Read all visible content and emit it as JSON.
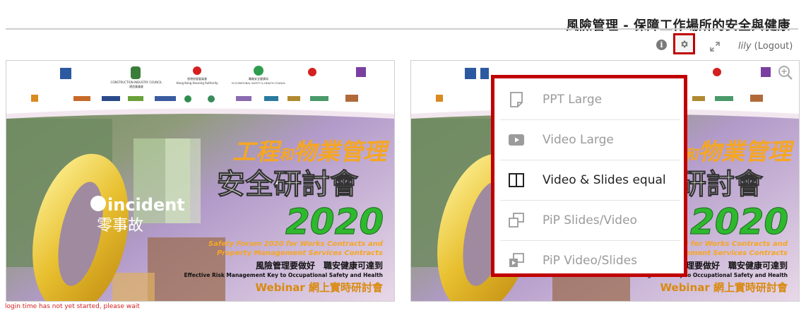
{
  "header": {
    "title": "風險管理 - 保障工作場所的安全與健康"
  },
  "toolbar": {
    "info_icon": "info-icon",
    "settings_icon": "gear-icon",
    "expand_icon": "expand-icon",
    "username": "lily",
    "logout_label": "(Logout)"
  },
  "slide": {
    "heading_orange_1": "工程",
    "heading_orange_small": "和",
    "heading_orange_2": "物業管理",
    "heading_white": "安全研討會",
    "year": "2020",
    "zero_word": "incident",
    "zero_chinese": "零事故",
    "forum_line1": "Safety Forum 2020 for Works Contracts and",
    "forum_line2": "Property Management Services Contracts",
    "motto_chinese": "風險管理要做好　職安健康可達到",
    "motto_english": "Effective Risk Management  Key to Occupational Safety and Health",
    "webinar": "Webinar 網上實時研討會",
    "logo_cic": "CONSTRUCTION INDUSTRY COUNCIL",
    "logo_cic_zh": "建造業議會",
    "logo_hkha": "Hong Kong Housing Authority",
    "logo_hkha_zh": "香港房屋委員會",
    "logo_oshc": "OCCUPATIONAL SAFETY & HEALTH COUNCIL",
    "logo_oshc_zh": "職業安全健康局"
  },
  "layout_menu": {
    "items": [
      {
        "label": "PPT Large",
        "icon": "slide-icon",
        "active": false
      },
      {
        "label": "Video Large",
        "icon": "video-play-icon",
        "active": false
      },
      {
        "label": "Video & Slides equal",
        "icon": "split-columns-icon",
        "active": true
      },
      {
        "label": "PiP Slides/Video",
        "icon": "pip-slides-video-icon",
        "active": false
      },
      {
        "label": "PiP Video/Slides",
        "icon": "pip-video-slides-icon",
        "active": false
      }
    ]
  },
  "status": {
    "message": "login time has not yet started, please wait"
  },
  "colors": {
    "highlight": "#c00000",
    "status_text": "#d42020",
    "slide_orange": "#f5a623",
    "slide_green": "#2eb82e"
  }
}
